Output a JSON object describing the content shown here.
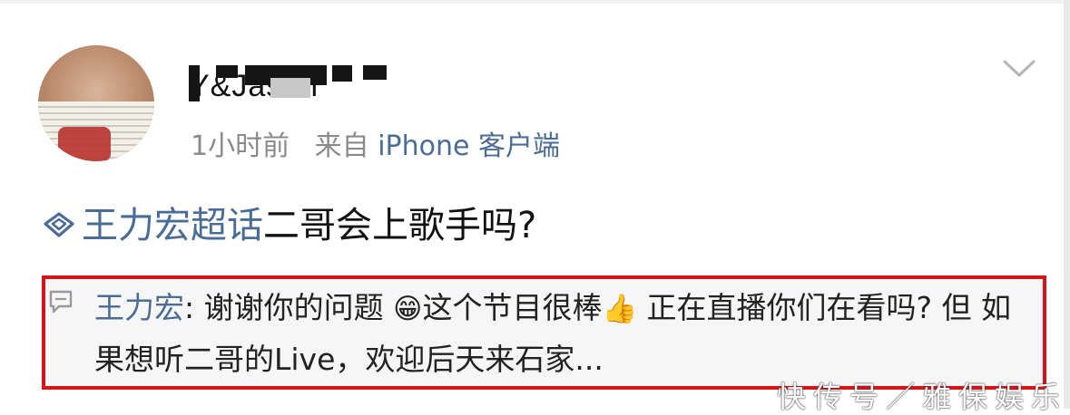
{
  "user": {
    "name": "Y&Jason",
    "time": "1小时前",
    "source_prefix": "来自",
    "client": "iPhone 客户端"
  },
  "post": {
    "topic_icon": "supertopic-diamond-icon",
    "topic": "王力宏超话",
    "text": "二哥会上歌手吗?"
  },
  "comment": {
    "icon": "comment-bubble-icon",
    "author": "王力宏",
    "separator": ": ",
    "text_part1": "谢谢你的问题 ",
    "emoji1": "😁",
    "text_part2": "这个节目很棒",
    "emoji2": "👍",
    "text_part3": " 正在直播你们在看吗? 但 如果想听二哥的Live，欢迎后天来石家..."
  },
  "watermark": "快传号／雅保娱乐",
  "colors": {
    "link": "#4a6c96",
    "highlight_border": "#d6151b",
    "meta_gray": "#8a8a8a"
  }
}
